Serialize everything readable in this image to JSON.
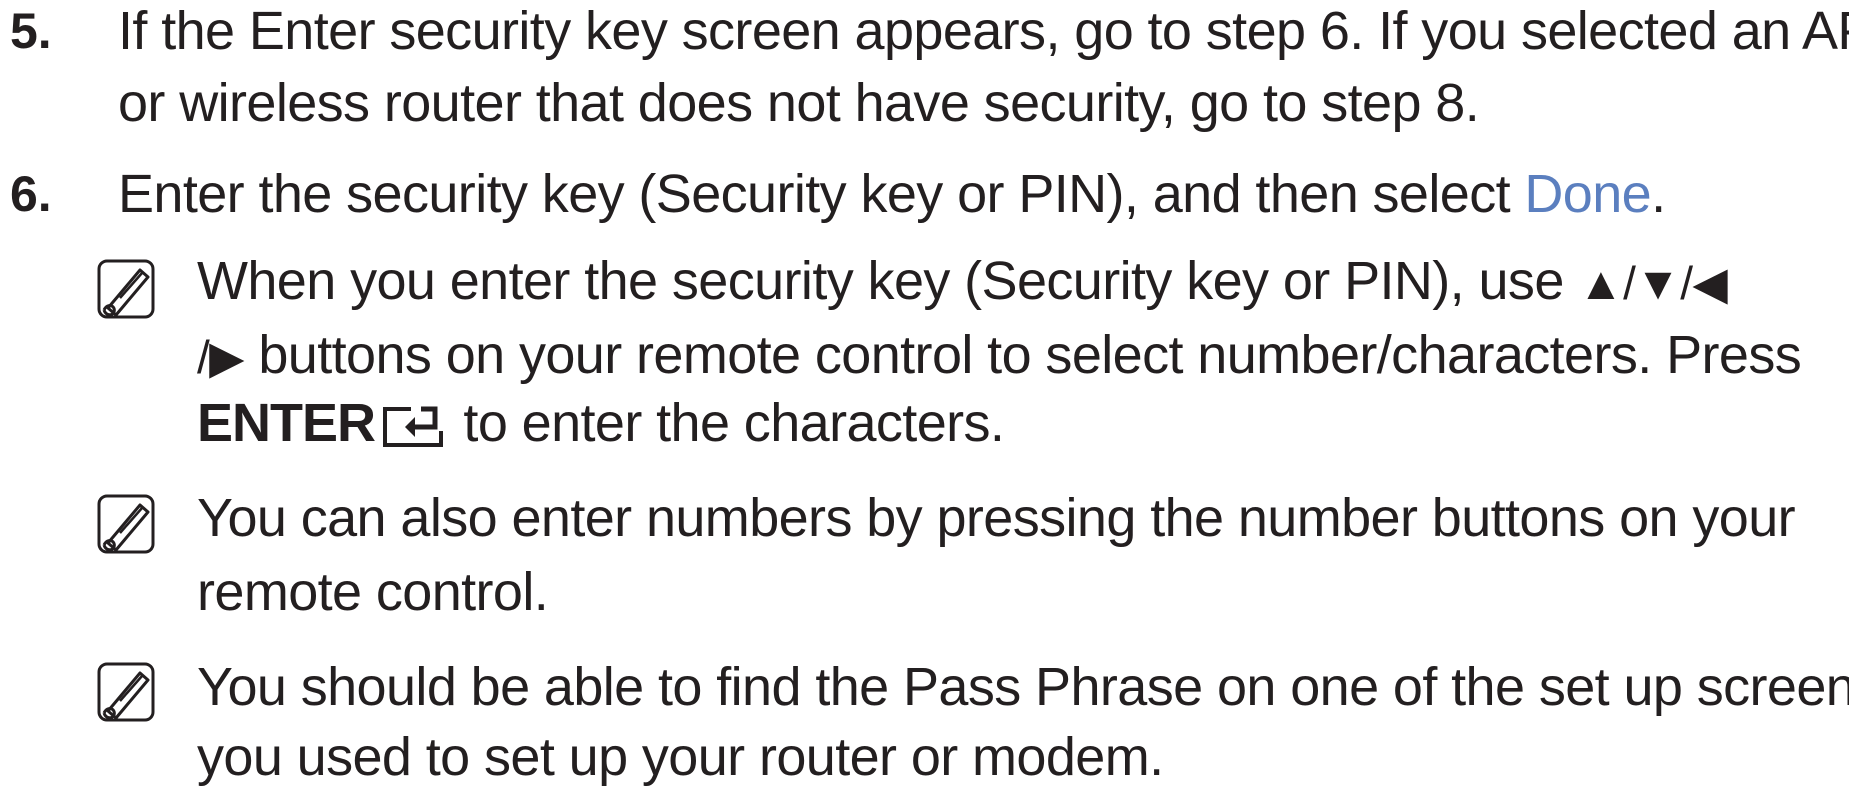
{
  "step5": {
    "number": "5.",
    "line1": "If the Enter security key screen appears, go to step 6. If you selected an AP",
    "line2": "or wireless router that does not have security, go to step 8."
  },
  "step6": {
    "number": "6.",
    "text_before": "Enter the security key (Security key or PIN), and then select ",
    "done": "Done",
    "text_after": "."
  },
  "note1": {
    "line1_text": "When you enter the security key (Security key or PIN), use ",
    "arrows_1": "▲/▼/◀",
    "line2_arrow": "/▶",
    "line2_text": " buttons on your remote control to select number/characters. Press",
    "enter_label": "ENTER",
    "line3_text": " to enter the characters."
  },
  "note2": {
    "line1": "You can also enter numbers by pressing the number buttons on your",
    "line2": "remote control."
  },
  "note3": {
    "line1": "You should be able to find the Pass Phrase on one of the set up screens",
    "line2": "you used to set up your router or modem."
  },
  "colors": {
    "text": "#231f20",
    "link": "#5b7fbf"
  },
  "icons": {
    "note": "note-pencil-icon",
    "enter": "enter-key-icon"
  }
}
